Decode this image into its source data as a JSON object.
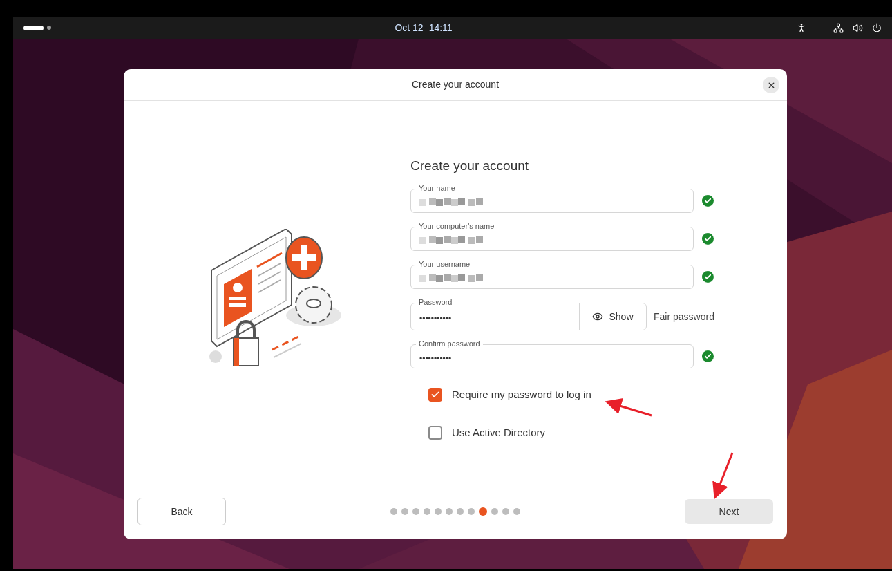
{
  "top_bar": {
    "date": "Oct 12",
    "time": "14:11"
  },
  "dialog": {
    "title": "Create your account",
    "heading": "Create your account",
    "fields": [
      {
        "label": "Your name",
        "kind": "pixelated",
        "valid": true
      },
      {
        "label": "Your computer's name",
        "kind": "pixelated",
        "valid": true
      },
      {
        "label": "Your username",
        "kind": "pixelated",
        "valid": true
      },
      {
        "label": "Password",
        "kind": "password",
        "value": "•••••••••••",
        "show_label": "Show",
        "strength": "Fair password"
      },
      {
        "label": "Confirm password",
        "kind": "password",
        "value": "•••••••••••",
        "valid": true
      }
    ],
    "checkboxes": [
      {
        "label": "Require my password to log in",
        "checked": true
      },
      {
        "label": "Use Active Directory",
        "checked": false
      }
    ],
    "back": "Back",
    "next": "Next",
    "steps": [
      {
        "selected": false
      },
      {
        "selected": false
      },
      {
        "selected": false
      },
      {
        "selected": false
      },
      {
        "selected": false
      },
      {
        "selected": false
      },
      {
        "selected": false
      },
      {
        "selected": false
      },
      {
        "selected": true
      },
      {
        "selected": false
      },
      {
        "selected": false
      },
      {
        "selected": false
      }
    ]
  }
}
